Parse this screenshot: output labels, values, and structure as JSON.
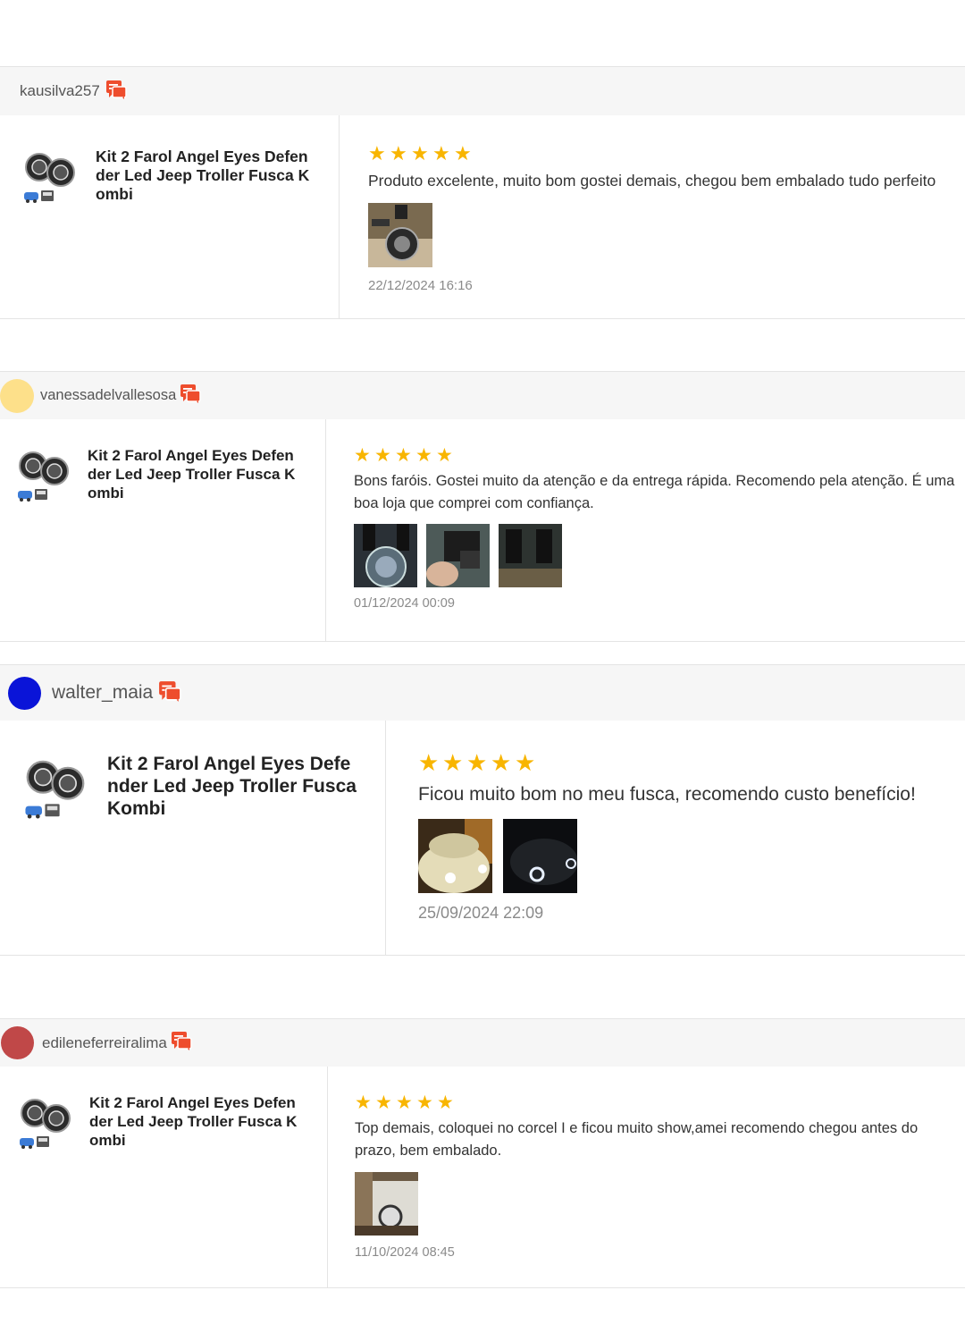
{
  "reviews": [
    {
      "username": "kausilva257",
      "avatar_color": "",
      "product": "Kit 2 Farol Angel Eyes Defender Led Jeep Troller Fusca Kombi",
      "rating": 5,
      "comment": "Produto excelente, muito bom gostei demais, chegou bem embalado tudo perfeito",
      "photos": 1,
      "date": "22/12/2024 16:16"
    },
    {
      "username": "vanessadelvallesosa",
      "avatar_color": "#fde08a",
      "product": "Kit 2 Farol Angel Eyes Defender Led Jeep Troller Fusca Kombi",
      "rating": 5,
      "comment": "Bons faróis. Gostei muito da atenção e da entrega rápida. Recomendo pela atenção. É uma boa loja que comprei com confiança.",
      "photos": 3,
      "date": "01/12/2024 00:09"
    },
    {
      "username": "walter_maia",
      "avatar_color": "#0a14d8",
      "product": "Kit 2 Farol Angel Eyes Defender Led Jeep Troller Fusca Kombi",
      "rating": 5,
      "comment": "Ficou muito bom no meu fusca, recomendo custo benefício!",
      "photos": 2,
      "date": "25/09/2024 22:09"
    },
    {
      "username": "edileneferreiralima",
      "avatar_color": "#c04848",
      "product": "Kit 2 Farol Angel Eyes Defender Led Jeep Troller Fusca Kombi",
      "rating": 5,
      "comment": "Top demais, coloquei no corcel I e ficou muito show,amei recomendo chegou antes do prazo, bem embalado.",
      "photos": 1,
      "date": "11/10/2024 08:45"
    }
  ],
  "colors": {
    "star": "#f8b500",
    "chat_icon": "#ee4d2d"
  },
  "icons": {
    "rating": "star-icon",
    "chat": "chat-icon"
  }
}
